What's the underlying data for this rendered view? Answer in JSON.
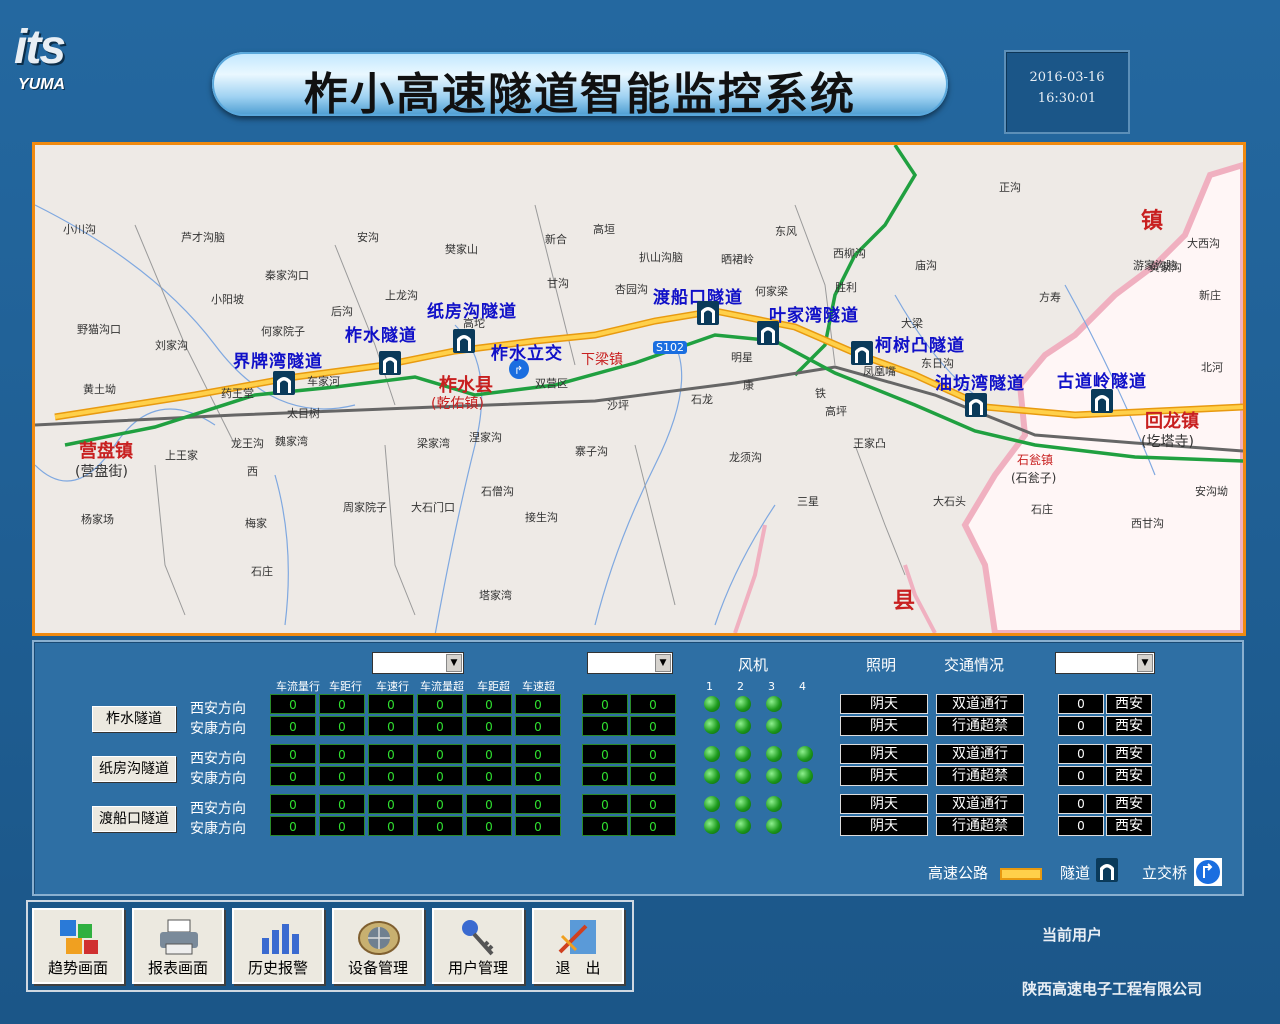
{
  "logo": {
    "its": "its",
    "yuma": "YUMA"
  },
  "title": "柞小高速隧道智能监控系统",
  "datetime": {
    "date": "2016-03-16",
    "time": "16:30:01"
  },
  "map": {
    "tunnels": [
      "界牌湾隧道",
      "柞水隧道",
      "纸房沟隧道",
      "渡船口隧道",
      "叶家湾隧道",
      "柯树凸隧道",
      "油坊湾隧道",
      "古道岭隧道"
    ],
    "interchange": "柞水立交",
    "places": {
      "yingpan": "营盘镇",
      "yingpan_sub": "(营盘街)",
      "zhashui": "柞水县",
      "zhashui_sub": "(乾佑镇)",
      "xialiang": "下梁镇",
      "huilong": "回龙镇",
      "huilong_sub": "(圪塔寺)",
      "shiwen": "石瓮镇",
      "shiwen_sub": "(石瓮子)",
      "zhen": "镇",
      "xian": "县",
      "road": "S102",
      "small": [
        "小川沟",
        "芦才沟脑",
        "安沟",
        "樊家山",
        "新合",
        "高垣",
        "东风",
        "正沟",
        "大西沟",
        "黄家沟",
        "秦家沟口",
        "小阳坡",
        "上龙沟",
        "高坨",
        "甘沟",
        "扒山沟脑",
        "晒裙岭",
        "西柳沟",
        "胜利",
        "庙沟",
        "游家沟脑",
        "方寿",
        "新庄",
        "野猫沟口",
        "刘家沟",
        "何家院子",
        "后沟",
        "杏园沟",
        "何家梁",
        "大梁",
        "东日沟",
        "北河",
        "黄土坳",
        "药王堂",
        "车家河",
        "太目树",
        "凤凰嘴",
        "沙坪",
        "双营区",
        "明星",
        "石龙",
        "康",
        "铁",
        "高坪",
        "魏家湾",
        "上王家",
        "龙王沟",
        "西",
        "梁家湾",
        "涅家沟",
        "寨子沟",
        "龙须沟",
        "王家凸",
        "杨家场",
        "周家院子",
        "大石门口",
        "石僧沟",
        "三星",
        "大石头",
        "石庄",
        "西甘沟",
        "石庄",
        "梅家",
        "接生沟",
        "塔家湾",
        "安沟坳",
        "回龙"
      ]
    }
  },
  "panel": {
    "headers": [
      "车流量行",
      "车距行",
      "车速行",
      "车流量超",
      "车距超",
      "车速超"
    ],
    "fan_header": "风机",
    "fan_numbers": [
      "1",
      "2",
      "3",
      "4"
    ],
    "light_header": "照明",
    "traffic_header": "交通情况",
    "tunnels": [
      {
        "name": "柞水隧道",
        "dirs": [
          "西安方向",
          "安康方向"
        ],
        "values": [
          [
            "0",
            "0",
            "0",
            "0",
            "0",
            "0"
          ],
          [
            "0",
            "0",
            "0",
            "0",
            "0",
            "0"
          ]
        ],
        "extra": [
          [
            "0",
            "0"
          ],
          [
            "0",
            "0"
          ]
        ],
        "fans": [
          3,
          3
        ],
        "light": [
          "阴天",
          "阴天"
        ],
        "traffic": [
          "双道通行",
          "行通超禁"
        ],
        "count": [
          "0",
          "0"
        ],
        "dest": [
          "西安",
          "西安"
        ]
      },
      {
        "name": "纸房沟隧道",
        "dirs": [
          "西安方向",
          "安康方向"
        ],
        "values": [
          [
            "0",
            "0",
            "0",
            "0",
            "0",
            "0"
          ],
          [
            "0",
            "0",
            "0",
            "0",
            "0",
            "0"
          ]
        ],
        "extra": [
          [
            "0",
            "0"
          ],
          [
            "0",
            "0"
          ]
        ],
        "fans": [
          4,
          4
        ],
        "light": [
          "阴天",
          "阴天"
        ],
        "traffic": [
          "双道通行",
          "行通超禁"
        ],
        "count": [
          "0",
          "0"
        ],
        "dest": [
          "西安",
          "西安"
        ]
      },
      {
        "name": "渡船口隧道",
        "dirs": [
          "西安方向",
          "安康方向"
        ],
        "values": [
          [
            "0",
            "0",
            "0",
            "0",
            "0",
            "0"
          ],
          [
            "0",
            "0",
            "0",
            "0",
            "0",
            "0"
          ]
        ],
        "extra": [
          [
            "0",
            "0"
          ],
          [
            "0",
            "0"
          ]
        ],
        "fans": [
          3,
          3
        ],
        "light": [
          "阴天",
          "阴天"
        ],
        "traffic": [
          "双道通行",
          "行通超禁"
        ],
        "count": [
          "0",
          "0"
        ],
        "dest": [
          "西安",
          "西安"
        ]
      }
    ],
    "legend": {
      "highway": "高速公路",
      "tunnel": "隧道",
      "interchange": "立交桥"
    }
  },
  "nav": [
    {
      "label": "趋势画面",
      "icon": "cubes-icon"
    },
    {
      "label": "报表画面",
      "icon": "printer-icon"
    },
    {
      "label": "历史报警",
      "icon": "bar-chart-icon"
    },
    {
      "label": "设备管理",
      "icon": "globe-icon"
    },
    {
      "label": "用户管理",
      "icon": "keys-icon"
    },
    {
      "label": "退　出",
      "icon": "exit-icon"
    }
  ],
  "current_user": "当前用户",
  "company": "陕西高速电子工程有限公司",
  "colors": {
    "highway": "#f5a800",
    "river": "#20a040",
    "tunnel_label": "#1010c8",
    "panel_bg": "#2e6fa4"
  }
}
